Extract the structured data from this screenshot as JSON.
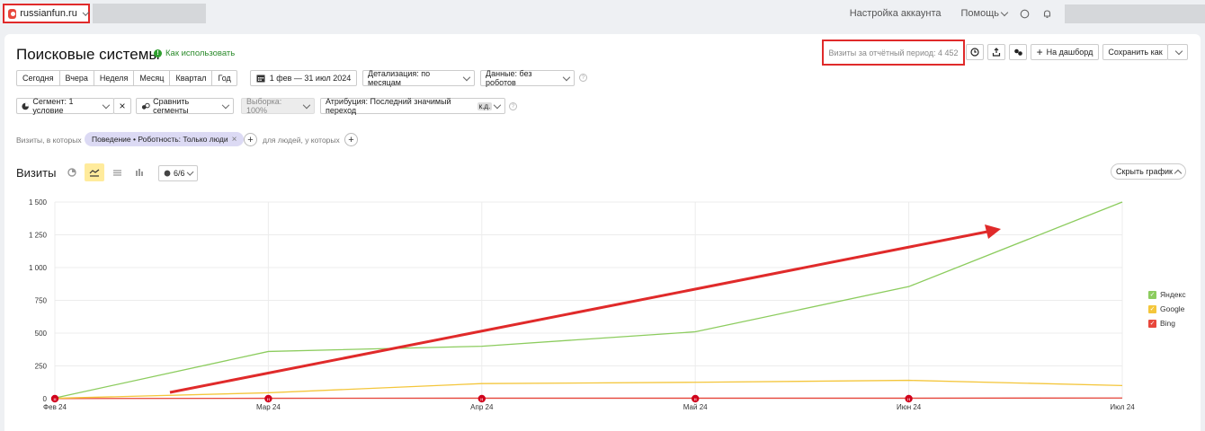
{
  "topbar": {
    "site": "russianfun.ru",
    "account_settings": "Настройка аккаунта",
    "help": "Помощь",
    "icons": [
      "site-counter-icon",
      "chevron-down-icon",
      "chat-icon",
      "bell-icon"
    ]
  },
  "report": {
    "title": "Поисковые системы",
    "how_to_use": "Как использовать",
    "visits_total_label": "Визиты за отчётный период: 4 452",
    "add_dashboard": "На дашборд",
    "save_as": "Сохранить как"
  },
  "period_buttons": [
    "Сегодня",
    "Вчера",
    "Неделя",
    "Месяц",
    "Квартал",
    "Год"
  ],
  "filters": {
    "date_range": "1 фев — 31 июл 2024",
    "detail": "Детализация: по месяцам",
    "data": "Данные: без роботов",
    "segment": "Сегмент: 1 условие",
    "compare": "Сравнить сегменты",
    "sample": "Выборка: 100%",
    "attribution": "Атрибуция: Последний значимый переход",
    "attribution_tag": "к.д."
  },
  "conditions": {
    "visits_prefix": "Визиты, в которых",
    "chip": "Поведение • Роботность: Только люди",
    "people_prefix": "для людей, у которых"
  },
  "chart_section": {
    "title": "Визиты",
    "series_count": "6/6",
    "hide_chart": "Скрыть график"
  },
  "colors": {
    "yandex": "#8ccc5e",
    "google": "#f4c63b",
    "bing": "#e8473c",
    "annotation": "#e02a2a",
    "active_view": "#ffeb9c"
  },
  "chart_data": {
    "type": "line",
    "categories": [
      "Фев 24",
      "Мар 24",
      "Апр 24",
      "Май 24",
      "Июн 24",
      "Июл 24"
    ],
    "yticks": [
      "0",
      "250",
      "500",
      "750",
      "1 000",
      "1 250",
      "1 500"
    ],
    "ylim": [
      0,
      1500
    ],
    "grid": true,
    "legend_position": "right",
    "series": [
      {
        "name": "Яндекс",
        "values": [
          5,
          360,
          400,
          510,
          855,
          1500
        ]
      },
      {
        "name": "Google",
        "values": [
          3,
          45,
          115,
          125,
          140,
          100
        ]
      },
      {
        "name": "Bing",
        "values": [
          1,
          3,
          4,
          4,
          4,
          5
        ]
      }
    ]
  }
}
